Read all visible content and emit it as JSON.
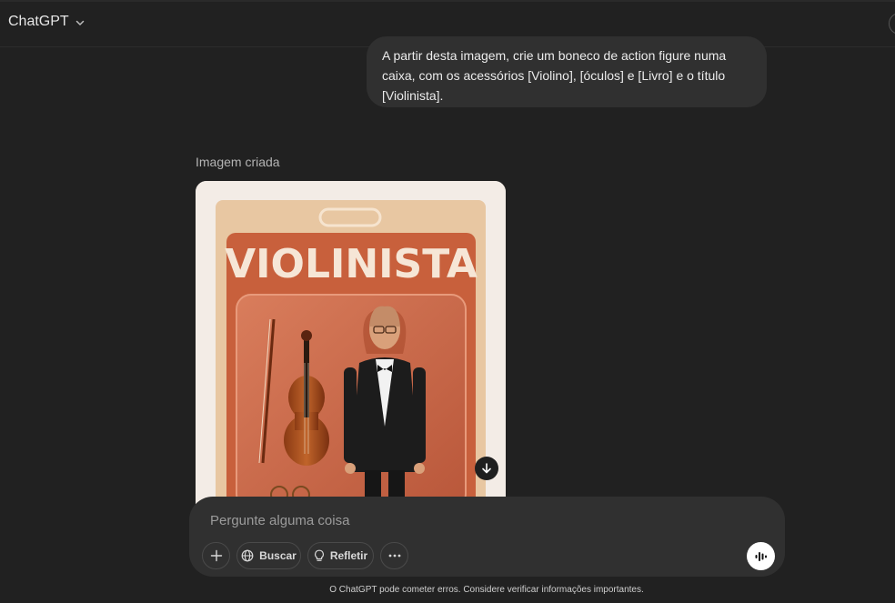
{
  "header": {
    "model_name": "ChatGPT"
  },
  "conversation": {
    "user_message_lines": [
      "A partir desta imagem, crie um boneco de action figure numa",
      "caixa, com os acessórios [Violino], [óculos] e [Livro] e o título",
      "[Violinista]."
    ],
    "image_label": "Imagem criada",
    "image_title": "VIOLINISTA"
  },
  "composer": {
    "placeholder": "Pergunte alguma coisa",
    "buttons": {
      "search_label": "Buscar",
      "reason_label": "Refletir"
    }
  },
  "footer": {
    "disclaimer": "O ChatGPT pode cometer erros. Considere verificar informações importantes."
  },
  "icons": [
    "chevron-down-icon",
    "download-icon",
    "plus-icon",
    "globe-icon",
    "lightbulb-icon",
    "more-icon",
    "voice-icon"
  ],
  "colors": {
    "background": "#212121",
    "bubble": "#303030",
    "package_orange": "#c9623f",
    "package_cream": "#e9c9a6"
  }
}
